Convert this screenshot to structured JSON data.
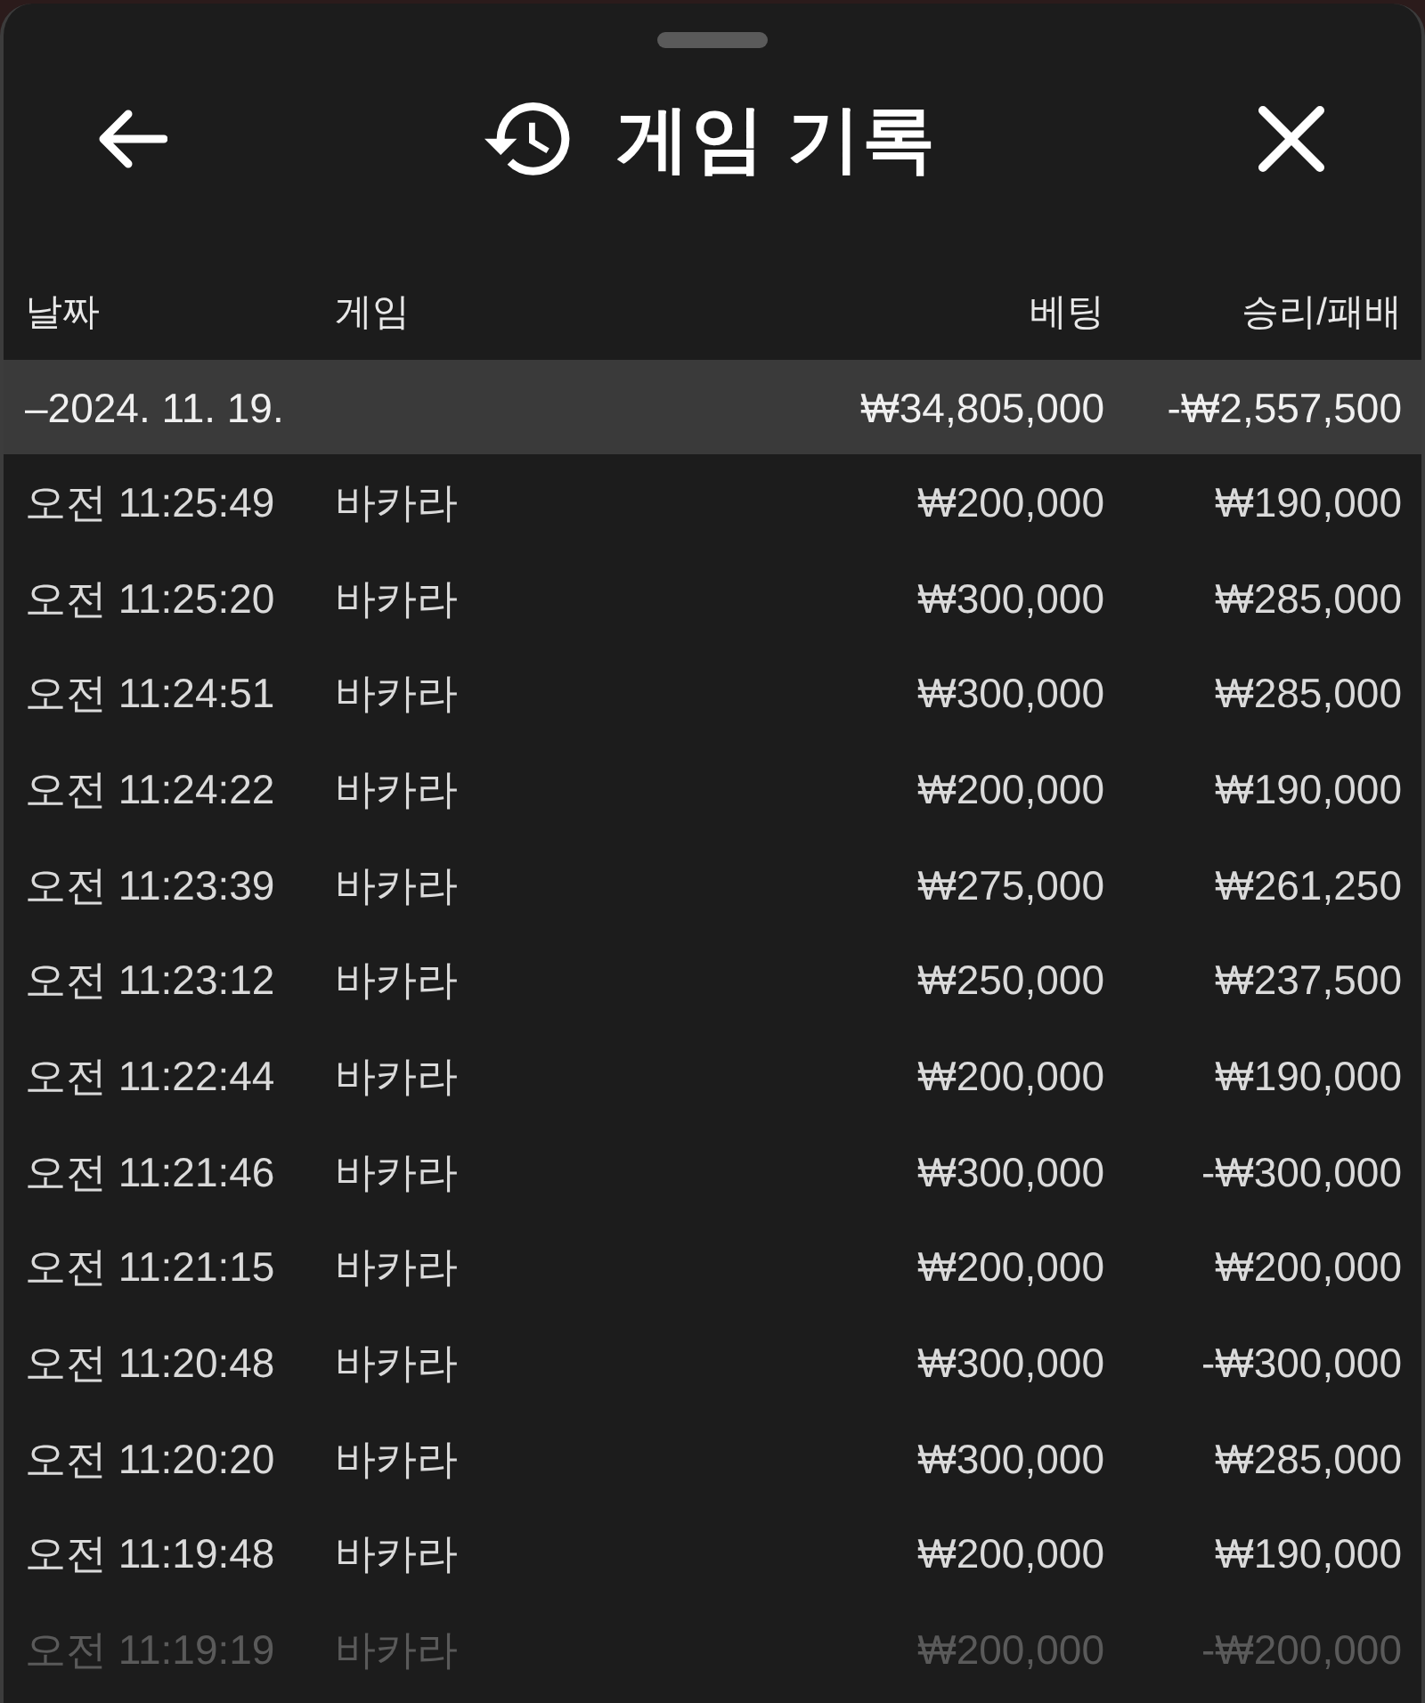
{
  "sheet": {
    "title": "게임 기록"
  },
  "table": {
    "columns": [
      "날짜",
      "게임",
      "베팅",
      "승리/패배"
    ],
    "groups": [
      {
        "date": "–2024. 11. 19.",
        "bet": "₩34,805,000",
        "result": "-₩2,557,500",
        "rows": [
          {
            "time": "오전 11:25:49",
            "game": "바카라",
            "bet": "₩200,000",
            "result": "₩190,000",
            "dimmed": false
          },
          {
            "time": "오전 11:25:20",
            "game": "바카라",
            "bet": "₩300,000",
            "result": "₩285,000",
            "dimmed": false
          },
          {
            "time": "오전 11:24:51",
            "game": "바카라",
            "bet": "₩300,000",
            "result": "₩285,000",
            "dimmed": false
          },
          {
            "time": "오전 11:24:22",
            "game": "바카라",
            "bet": "₩200,000",
            "result": "₩190,000",
            "dimmed": false
          },
          {
            "time": "오전 11:23:39",
            "game": "바카라",
            "bet": "₩275,000",
            "result": "₩261,250",
            "dimmed": false
          },
          {
            "time": "오전 11:23:12",
            "game": "바카라",
            "bet": "₩250,000",
            "result": "₩237,500",
            "dimmed": false
          },
          {
            "time": "오전 11:22:44",
            "game": "바카라",
            "bet": "₩200,000",
            "result": "₩190,000",
            "dimmed": false
          },
          {
            "time": "오전 11:21:46",
            "game": "바카라",
            "bet": "₩300,000",
            "result": "-₩300,000",
            "dimmed": false
          },
          {
            "time": "오전 11:21:15",
            "game": "바카라",
            "bet": "₩200,000",
            "result": "₩200,000",
            "dimmed": false
          },
          {
            "time": "오전 11:20:48",
            "game": "바카라",
            "bet": "₩300,000",
            "result": "-₩300,000",
            "dimmed": false
          },
          {
            "time": "오전 11:20:20",
            "game": "바카라",
            "bet": "₩300,000",
            "result": "₩285,000",
            "dimmed": false
          },
          {
            "time": "오전 11:19:48",
            "game": "바카라",
            "bet": "₩200,000",
            "result": "₩190,000",
            "dimmed": false
          },
          {
            "time": "오전 11:19:19",
            "game": "바카라",
            "bet": "₩200,000",
            "result": "-₩200,000",
            "dimmed": true
          }
        ]
      }
    ]
  }
}
